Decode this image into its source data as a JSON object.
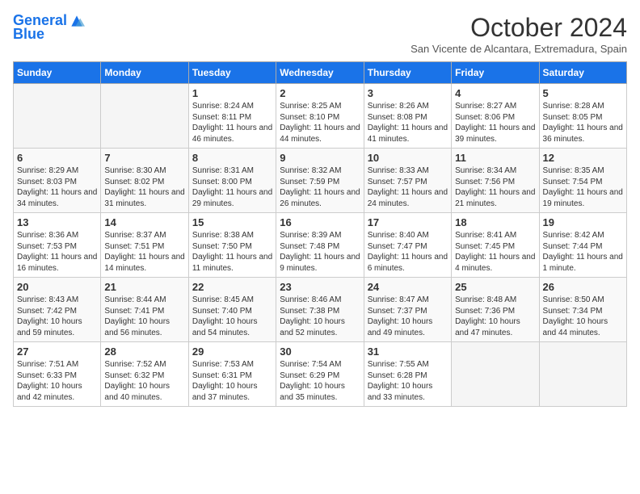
{
  "header": {
    "logo_line1": "General",
    "logo_line2": "Blue",
    "month": "October 2024",
    "location": "San Vicente de Alcantara, Extremadura, Spain"
  },
  "weekdays": [
    "Sunday",
    "Monday",
    "Tuesday",
    "Wednesday",
    "Thursday",
    "Friday",
    "Saturday"
  ],
  "weeks": [
    [
      {
        "day": "",
        "info": ""
      },
      {
        "day": "",
        "info": ""
      },
      {
        "day": "1",
        "info": "Sunrise: 8:24 AM\nSunset: 8:11 PM\nDaylight: 11 hours and 46 minutes."
      },
      {
        "day": "2",
        "info": "Sunrise: 8:25 AM\nSunset: 8:10 PM\nDaylight: 11 hours and 44 minutes."
      },
      {
        "day": "3",
        "info": "Sunrise: 8:26 AM\nSunset: 8:08 PM\nDaylight: 11 hours and 41 minutes."
      },
      {
        "day": "4",
        "info": "Sunrise: 8:27 AM\nSunset: 8:06 PM\nDaylight: 11 hours and 39 minutes."
      },
      {
        "day": "5",
        "info": "Sunrise: 8:28 AM\nSunset: 8:05 PM\nDaylight: 11 hours and 36 minutes."
      }
    ],
    [
      {
        "day": "6",
        "info": "Sunrise: 8:29 AM\nSunset: 8:03 PM\nDaylight: 11 hours and 34 minutes."
      },
      {
        "day": "7",
        "info": "Sunrise: 8:30 AM\nSunset: 8:02 PM\nDaylight: 11 hours and 31 minutes."
      },
      {
        "day": "8",
        "info": "Sunrise: 8:31 AM\nSunset: 8:00 PM\nDaylight: 11 hours and 29 minutes."
      },
      {
        "day": "9",
        "info": "Sunrise: 8:32 AM\nSunset: 7:59 PM\nDaylight: 11 hours and 26 minutes."
      },
      {
        "day": "10",
        "info": "Sunrise: 8:33 AM\nSunset: 7:57 PM\nDaylight: 11 hours and 24 minutes."
      },
      {
        "day": "11",
        "info": "Sunrise: 8:34 AM\nSunset: 7:56 PM\nDaylight: 11 hours and 21 minutes."
      },
      {
        "day": "12",
        "info": "Sunrise: 8:35 AM\nSunset: 7:54 PM\nDaylight: 11 hours and 19 minutes."
      }
    ],
    [
      {
        "day": "13",
        "info": "Sunrise: 8:36 AM\nSunset: 7:53 PM\nDaylight: 11 hours and 16 minutes."
      },
      {
        "day": "14",
        "info": "Sunrise: 8:37 AM\nSunset: 7:51 PM\nDaylight: 11 hours and 14 minutes."
      },
      {
        "day": "15",
        "info": "Sunrise: 8:38 AM\nSunset: 7:50 PM\nDaylight: 11 hours and 11 minutes."
      },
      {
        "day": "16",
        "info": "Sunrise: 8:39 AM\nSunset: 7:48 PM\nDaylight: 11 hours and 9 minutes."
      },
      {
        "day": "17",
        "info": "Sunrise: 8:40 AM\nSunset: 7:47 PM\nDaylight: 11 hours and 6 minutes."
      },
      {
        "day": "18",
        "info": "Sunrise: 8:41 AM\nSunset: 7:45 PM\nDaylight: 11 hours and 4 minutes."
      },
      {
        "day": "19",
        "info": "Sunrise: 8:42 AM\nSunset: 7:44 PM\nDaylight: 11 hours and 1 minute."
      }
    ],
    [
      {
        "day": "20",
        "info": "Sunrise: 8:43 AM\nSunset: 7:42 PM\nDaylight: 10 hours and 59 minutes."
      },
      {
        "day": "21",
        "info": "Sunrise: 8:44 AM\nSunset: 7:41 PM\nDaylight: 10 hours and 56 minutes."
      },
      {
        "day": "22",
        "info": "Sunrise: 8:45 AM\nSunset: 7:40 PM\nDaylight: 10 hours and 54 minutes."
      },
      {
        "day": "23",
        "info": "Sunrise: 8:46 AM\nSunset: 7:38 PM\nDaylight: 10 hours and 52 minutes."
      },
      {
        "day": "24",
        "info": "Sunrise: 8:47 AM\nSunset: 7:37 PM\nDaylight: 10 hours and 49 minutes."
      },
      {
        "day": "25",
        "info": "Sunrise: 8:48 AM\nSunset: 7:36 PM\nDaylight: 10 hours and 47 minutes."
      },
      {
        "day": "26",
        "info": "Sunrise: 8:50 AM\nSunset: 7:34 PM\nDaylight: 10 hours and 44 minutes."
      }
    ],
    [
      {
        "day": "27",
        "info": "Sunrise: 7:51 AM\nSunset: 6:33 PM\nDaylight: 10 hours and 42 minutes."
      },
      {
        "day": "28",
        "info": "Sunrise: 7:52 AM\nSunset: 6:32 PM\nDaylight: 10 hours and 40 minutes."
      },
      {
        "day": "29",
        "info": "Sunrise: 7:53 AM\nSunset: 6:31 PM\nDaylight: 10 hours and 37 minutes."
      },
      {
        "day": "30",
        "info": "Sunrise: 7:54 AM\nSunset: 6:29 PM\nDaylight: 10 hours and 35 minutes."
      },
      {
        "day": "31",
        "info": "Sunrise: 7:55 AM\nSunset: 6:28 PM\nDaylight: 10 hours and 33 minutes."
      },
      {
        "day": "",
        "info": ""
      },
      {
        "day": "",
        "info": ""
      }
    ]
  ]
}
